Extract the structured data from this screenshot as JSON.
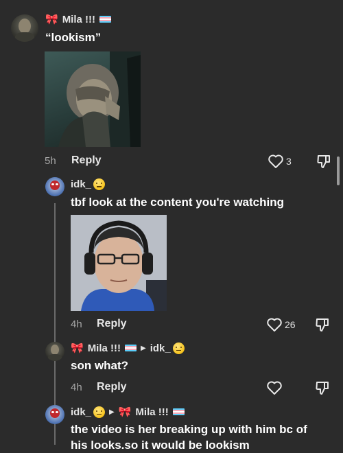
{
  "comments": [
    {
      "username": "Mila !!!",
      "text": "“lookism”",
      "time": "5h",
      "reply_label": "Reply",
      "likes": "3"
    },
    {
      "username": "idk_",
      "text": "tbf look at the content you're watching",
      "time": "4h",
      "reply_label": "Reply",
      "likes": "26"
    },
    {
      "username": "Mila !!!",
      "reply_to": "idk_",
      "text": "son what?",
      "time": "4h",
      "reply_label": "Reply",
      "likes": ""
    },
    {
      "username": "idk_",
      "reply_to": "Mila !!!",
      "text_line1": "the video is her breaking up with him bc of",
      "text_line2": "his looks.so it would be lookism"
    }
  ],
  "icons": {
    "like": "heart-outline-icon",
    "dislike": "thumbs-down-outline-icon",
    "username_prefix": "bow-icon",
    "flag": "trans-flag-icon",
    "emoji": "grimace-emoji-icon"
  },
  "colors": {
    "background": "#2b2b2b",
    "text": "#ffffff",
    "muted": "#a8a8a8"
  }
}
